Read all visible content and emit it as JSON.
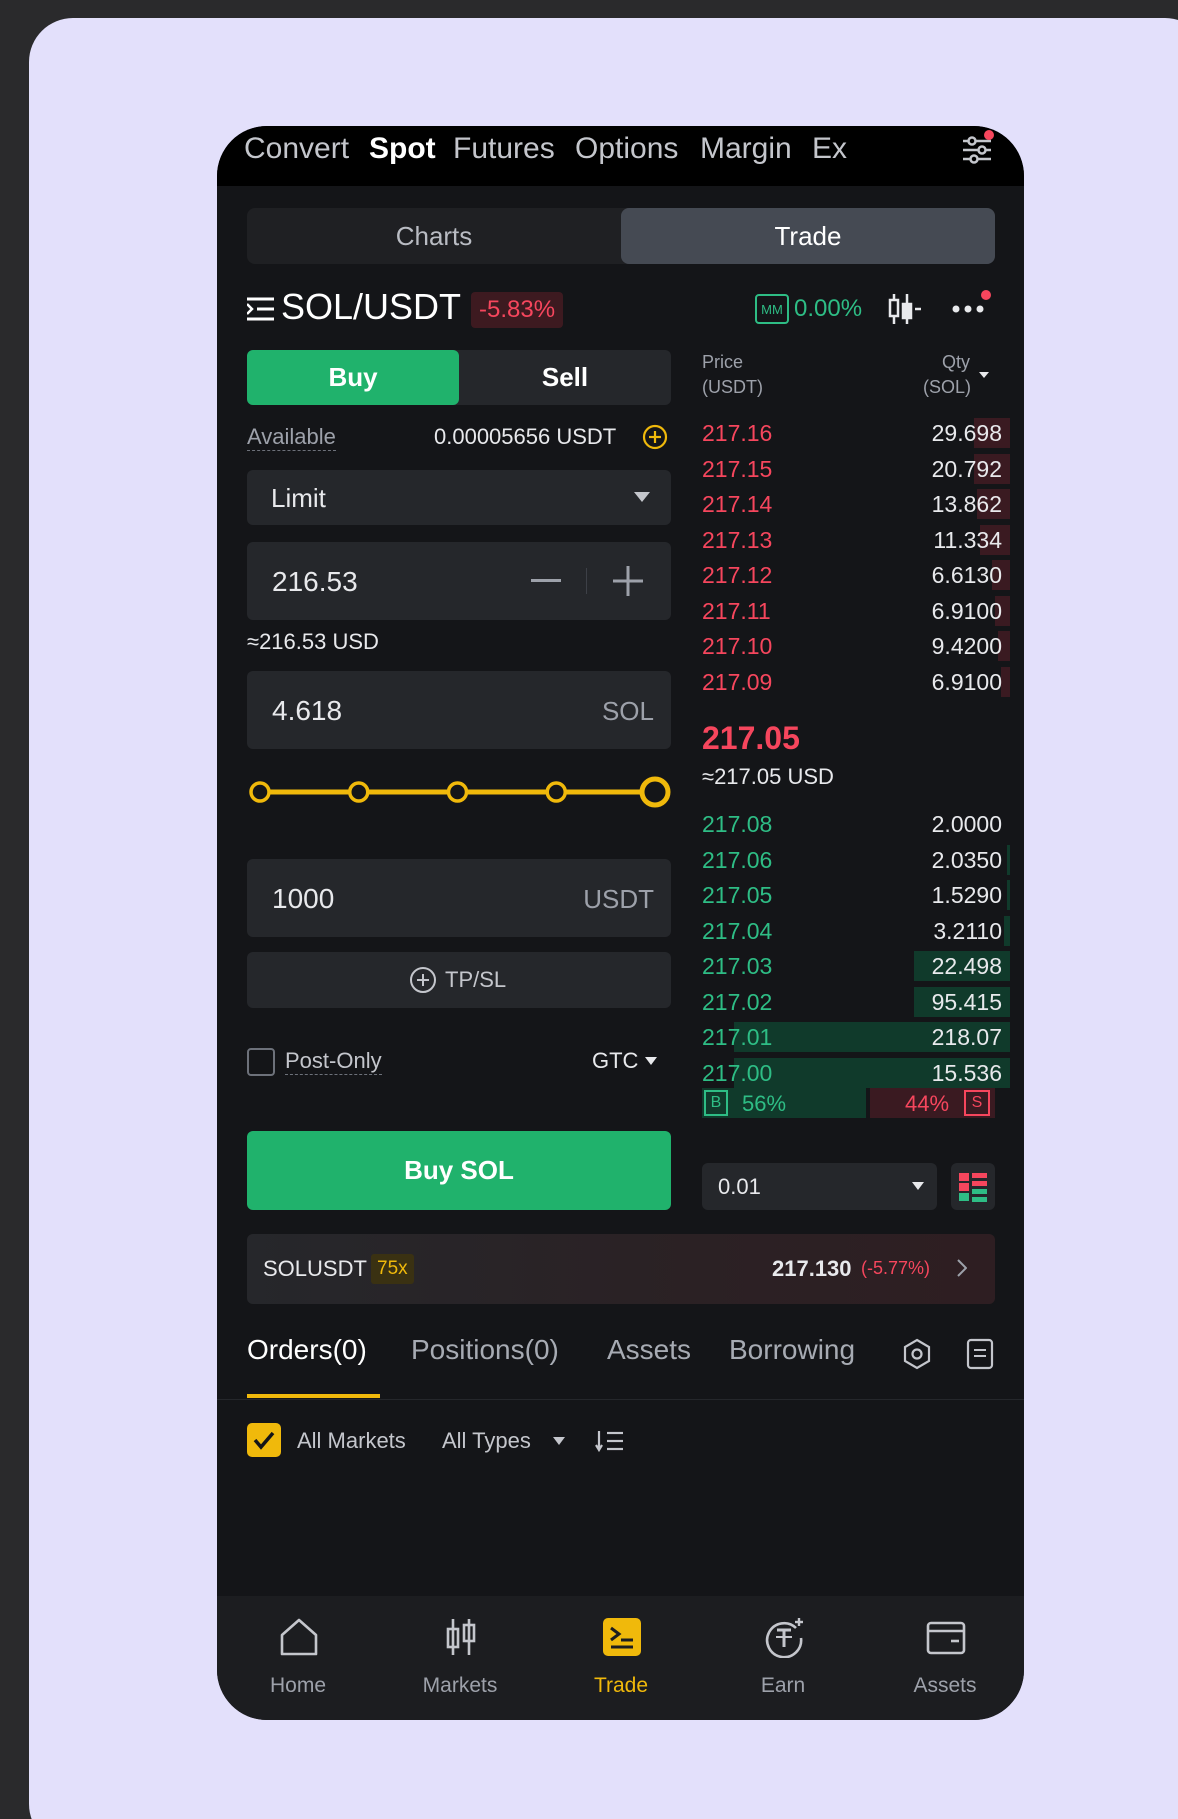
{
  "top_nav": [
    "Convert",
    "Spot",
    "Futures",
    "Options",
    "Margin",
    "Ex"
  ],
  "segments": {
    "charts": "Charts",
    "trade": "Trade"
  },
  "pair": {
    "symbol": "SOL/USDT",
    "change": "-5.83%",
    "mm_label": "MM",
    "mm_value": "0.00%"
  },
  "form": {
    "buy": "Buy",
    "sell": "Sell",
    "available_label": "Available",
    "available_value": "0.00005656 USDT",
    "order_type": "Limit",
    "price": "216.53",
    "price_usd": "≈216.53 USD",
    "amount": "4.618",
    "amount_unit": "SOL",
    "slider_percent": 100,
    "total": "1000",
    "total_unit": "USDT",
    "tpsl": "TP/SL",
    "post_only": "Post-Only",
    "tif": "GTC",
    "submit": "Buy SOL"
  },
  "orderbook": {
    "price_header_1": "Price",
    "price_header_2": "(USDT)",
    "qty_header_1": "Qty",
    "qty_header_2": "(SOL)",
    "asks": [
      {
        "price": "217.16",
        "qty": "29.698",
        "depth": 0.12
      },
      {
        "price": "217.15",
        "qty": "20.792",
        "depth": 0.12
      },
      {
        "price": "217.14",
        "qty": "13.862",
        "depth": 0.11
      },
      {
        "price": "217.13",
        "qty": "11.334",
        "depth": 0.1
      },
      {
        "price": "217.12",
        "qty": "6.6130",
        "depth": 0.06
      },
      {
        "price": "217.11",
        "qty": "6.9100",
        "depth": 0.05
      },
      {
        "price": "217.10",
        "qty": "9.4200",
        "depth": 0.04
      },
      {
        "price": "217.09",
        "qty": "6.9100",
        "depth": 0.03
      }
    ],
    "mid_price": "217.05",
    "mid_usd": "≈217.05 USD",
    "bids": [
      {
        "price": "217.08",
        "qty": "2.0000",
        "depth": 0.0
      },
      {
        "price": "217.06",
        "qty": "2.0350",
        "depth": 0.01
      },
      {
        "price": "217.05",
        "qty": "1.5290",
        "depth": 0.01
      },
      {
        "price": "217.04",
        "qty": "3.2110",
        "depth": 0.02
      },
      {
        "price": "217.03",
        "qty": "22.498",
        "depth": 0.32
      },
      {
        "price": "217.02",
        "qty": "95.415",
        "depth": 0.32
      },
      {
        "price": "217.01",
        "qty": "218.07",
        "depth": 0.92
      },
      {
        "price": "217.00",
        "qty": "15.536",
        "depth": 0.92
      }
    ],
    "buy_pct": "56%",
    "sell_pct": "44%",
    "b_label": "B",
    "s_label": "S",
    "precision": "0.01"
  },
  "ticker": {
    "symbol": "SOLUSDT",
    "leverage": "75x",
    "price": "217.130",
    "change": "(-5.77%)"
  },
  "tabs": [
    "Orders(0)",
    "Positions(0)",
    "Assets",
    "Borrowing"
  ],
  "filters": {
    "all_markets": "All Markets",
    "all_types": "All Types"
  },
  "bottom_nav": [
    "Home",
    "Markets",
    "Trade",
    "Earn",
    "Assets"
  ],
  "colors": {
    "accent": "#f0b90b",
    "buy": "#20b26c",
    "sell": "#f6465d"
  }
}
